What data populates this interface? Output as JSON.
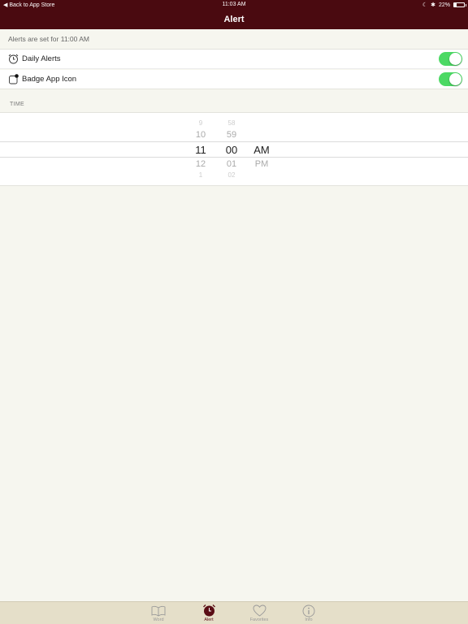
{
  "status_bar": {
    "back_label": "Back to App Store",
    "time": "11:03 AM",
    "battery": "22%",
    "battery_level": 0.22
  },
  "nav": {
    "title": "Alert"
  },
  "summary": {
    "text": "Alerts are set for 11:00 AM"
  },
  "settings": {
    "daily_alerts": {
      "label": "Daily Alerts",
      "on": true
    },
    "badge_app_icon": {
      "label": "Badge App Icon",
      "on": true
    }
  },
  "time_section": {
    "header": "TIME"
  },
  "picker": {
    "hours": [
      "9",
      "10",
      "11",
      "12",
      "1"
    ],
    "minutes": [
      "58",
      "59",
      "00",
      "01",
      "02"
    ],
    "periods": [
      "",
      "",
      "AM",
      "PM",
      ""
    ]
  },
  "tabs": [
    {
      "label": "Word",
      "icon": "book-icon",
      "active": false
    },
    {
      "label": "Alert",
      "icon": "alarm-clock-icon",
      "active": true
    },
    {
      "label": "Favorites",
      "icon": "heart-icon",
      "active": false
    },
    {
      "label": "Info",
      "icon": "info-icon",
      "active": false
    }
  ],
  "colors": {
    "nav_background": "#4a0a10",
    "toggle_on": "#4cd964",
    "tab_bar_background": "#e5dfc9",
    "tab_active": "#5a0d15"
  }
}
